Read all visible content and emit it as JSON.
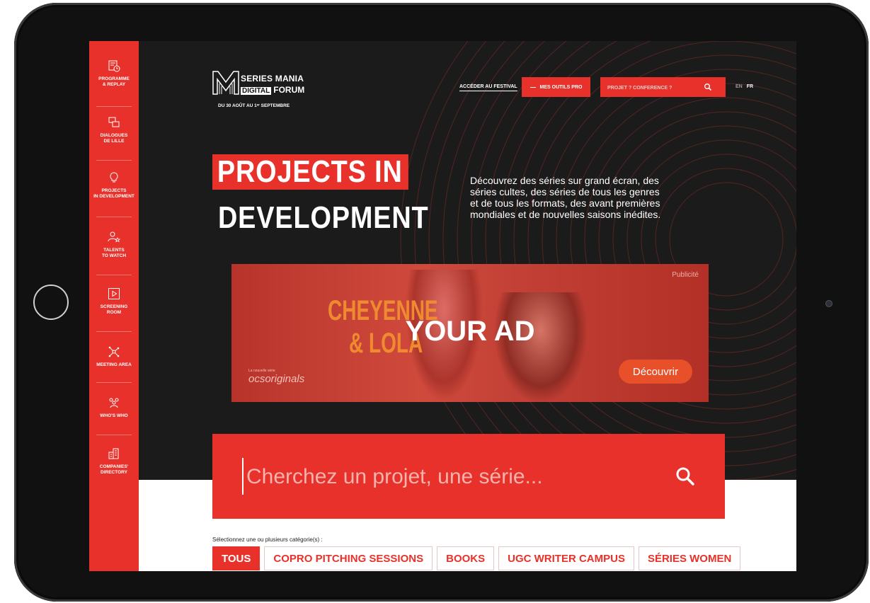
{
  "sidebar": {
    "items": [
      {
        "icon": "calendar-clock-icon",
        "label": "PROGRAMME\n& REPLAY"
      },
      {
        "icon": "chat-bubbles-icon",
        "label": "DIALOGUES\nDE LILLE"
      },
      {
        "icon": "lightbulb-icon",
        "label": "PROJECTS\nIN DEVELOPMENT"
      },
      {
        "icon": "user-star-icon",
        "label": "TALENTS\nTO WATCH"
      },
      {
        "icon": "play-screen-icon",
        "label": "SCREENING\nROOM"
      },
      {
        "icon": "network-icon",
        "label": "MEETING AREA"
      },
      {
        "icon": "people-group-icon",
        "label": "WHO'S WHO"
      },
      {
        "icon": "buildings-icon",
        "label": "COMPANIES'\nDIRECTORY"
      }
    ]
  },
  "header": {
    "logo_line1": "SERIES MANIA",
    "logo_digital": "DIGITAL",
    "logo_forum": "FORUM",
    "logo_date": "DU 30 AOÛT AU 1ᵉʳ SEPTEMBRE",
    "festival_link": "ACCÉDER AU FESTIVAL",
    "tools_button": "MES OUTILS PRO",
    "search_placeholder": "PROJET ? CONFÉRENCE ?",
    "lang_en": "EN",
    "lang_fr": "FR"
  },
  "hero": {
    "title_line1": "PROJECTS IN",
    "title_line2": "DEVELOPMENT",
    "description": "Découvrez des séries sur grand écran, des séries cultes, des séries de tous les genres et de tous les formats, des avant premières mondiales et de nouvelles saisons inédites."
  },
  "ad": {
    "pub_label": "Publicité",
    "show_title_1": "CHEYENNE",
    "show_title_2": "& LOLA",
    "overlay": "YOUR AD",
    "brand_small": "La nouvelle série",
    "brand": "ocsoriginals",
    "cta": "Découvrir"
  },
  "search": {
    "placeholder": "Cherchez un projet, une série..."
  },
  "categories": {
    "label": "Sélectionnez une ou plusieurs catégorie(s) :",
    "items": [
      "TOUS",
      "COPRO PITCHING SESSIONS",
      "BOOKS",
      "UGC WRITER CAMPUS",
      "SÉRIES WOMEN"
    ]
  },
  "colors": {
    "brand_red": "#e8312a",
    "dark_bg": "#1b1b1b",
    "ad_orange": "#f08a30"
  }
}
